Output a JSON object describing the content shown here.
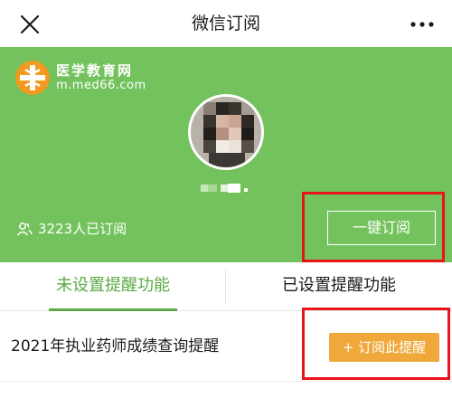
{
  "header": {
    "title": "微信订阅",
    "close_icon": "close-icon",
    "more_icon": "more-icon"
  },
  "banner": {
    "background": "#74c25d",
    "logo": {
      "name": "医学教育网",
      "url": "m.med66.com"
    },
    "subscriber_count": "3223人已订阅",
    "subscribe_all_label": "一键订阅"
  },
  "tabs": [
    {
      "label": "未设置提醒功能",
      "active": true
    },
    {
      "label": "已设置提醒功能",
      "active": false
    }
  ],
  "reminders": [
    {
      "title": "2021年执业药师成绩查询提醒",
      "button_label": "+ 订阅此提醒",
      "button_color": "#f0a83a"
    }
  ],
  "accent_color": "#5aaa45",
  "annotation_color": "#e8141b"
}
